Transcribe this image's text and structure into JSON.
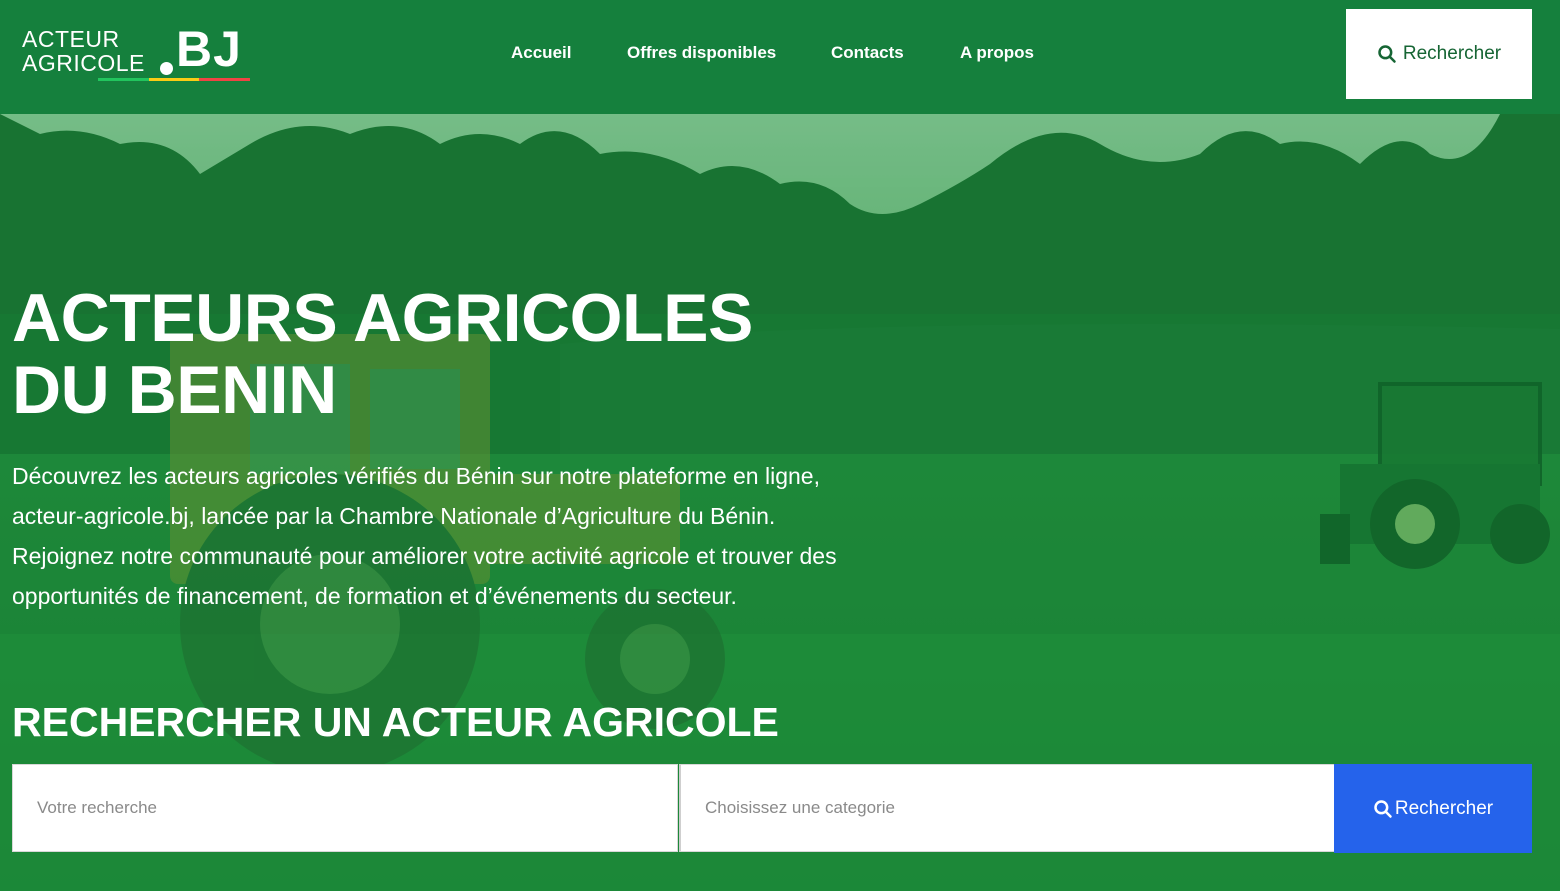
{
  "brand": {
    "line1": "ACTEUR",
    "line2": "AGRICOLE",
    "suffix": "BJ",
    "flag_colors": [
      "#22c55e",
      "#facc15",
      "#ef4444"
    ]
  },
  "nav": {
    "items": [
      {
        "label": "Accueil"
      },
      {
        "label": "Offres disponibles"
      },
      {
        "label": "Contacts"
      },
      {
        "label": "A propos"
      }
    ],
    "search_button": {
      "label": "Rechercher",
      "icon": "search-icon"
    }
  },
  "hero": {
    "title_line1": "ACTEURS AGRICOLES",
    "title_line2": "DU BENIN",
    "description": "Découvrez les acteurs agricoles vérifiés du Bénin sur notre plateforme en ligne, acteur-agricole.bj, lancée par la Chambre Nationale d’Agriculture du Bénin. Rejoignez notre communauté pour améliorer votre activité agricole et trouver des opportunités de financement, de formation et d’événements du secteur."
  },
  "search": {
    "heading": "RECHERCHER UN ACTEUR AGRICOLE",
    "input_placeholder": "Votre recherche",
    "category_placeholder": "Choisissez une categorie",
    "submit_label": "Rechercher",
    "submit_icon": "search-icon"
  },
  "colors": {
    "header_green": "#15803d",
    "hero_overlay_green": "#16a34a",
    "submit_blue": "#2563eb"
  }
}
